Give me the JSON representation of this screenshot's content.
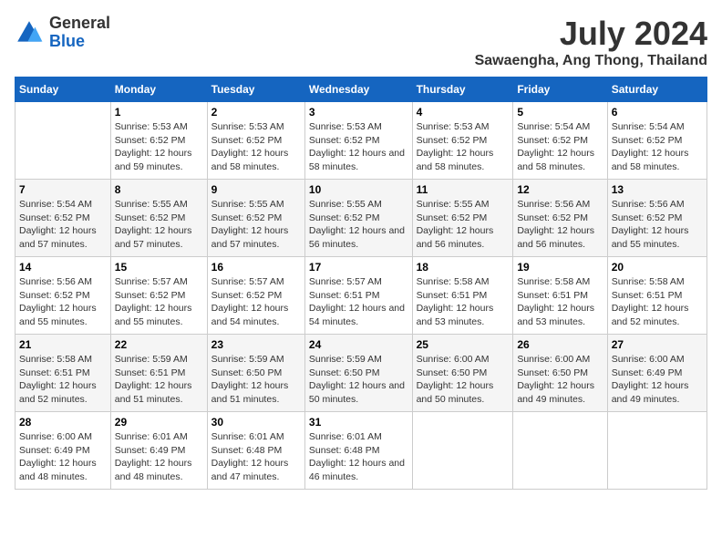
{
  "logo": {
    "general": "General",
    "blue": "Blue"
  },
  "header": {
    "month": "July 2024",
    "location": "Sawaengha, Ang Thong, Thailand"
  },
  "days_of_week": [
    "Sunday",
    "Monday",
    "Tuesday",
    "Wednesday",
    "Thursday",
    "Friday",
    "Saturday"
  ],
  "weeks": [
    [
      {
        "day": "",
        "empty": true
      },
      {
        "day": "1",
        "sunrise": "Sunrise: 5:53 AM",
        "sunset": "Sunset: 6:52 PM",
        "daylight": "Daylight: 12 hours and 59 minutes."
      },
      {
        "day": "2",
        "sunrise": "Sunrise: 5:53 AM",
        "sunset": "Sunset: 6:52 PM",
        "daylight": "Daylight: 12 hours and 58 minutes."
      },
      {
        "day": "3",
        "sunrise": "Sunrise: 5:53 AM",
        "sunset": "Sunset: 6:52 PM",
        "daylight": "Daylight: 12 hours and 58 minutes."
      },
      {
        "day": "4",
        "sunrise": "Sunrise: 5:53 AM",
        "sunset": "Sunset: 6:52 PM",
        "daylight": "Daylight: 12 hours and 58 minutes."
      },
      {
        "day": "5",
        "sunrise": "Sunrise: 5:54 AM",
        "sunset": "Sunset: 6:52 PM",
        "daylight": "Daylight: 12 hours and 58 minutes."
      },
      {
        "day": "6",
        "sunrise": "Sunrise: 5:54 AM",
        "sunset": "Sunset: 6:52 PM",
        "daylight": "Daylight: 12 hours and 58 minutes."
      }
    ],
    [
      {
        "day": "7",
        "sunrise": "Sunrise: 5:54 AM",
        "sunset": "Sunset: 6:52 PM",
        "daylight": "Daylight: 12 hours and 57 minutes."
      },
      {
        "day": "8",
        "sunrise": "Sunrise: 5:55 AM",
        "sunset": "Sunset: 6:52 PM",
        "daylight": "Daylight: 12 hours and 57 minutes."
      },
      {
        "day": "9",
        "sunrise": "Sunrise: 5:55 AM",
        "sunset": "Sunset: 6:52 PM",
        "daylight": "Daylight: 12 hours and 57 minutes."
      },
      {
        "day": "10",
        "sunrise": "Sunrise: 5:55 AM",
        "sunset": "Sunset: 6:52 PM",
        "daylight": "Daylight: 12 hours and 56 minutes."
      },
      {
        "day": "11",
        "sunrise": "Sunrise: 5:55 AM",
        "sunset": "Sunset: 6:52 PM",
        "daylight": "Daylight: 12 hours and 56 minutes."
      },
      {
        "day": "12",
        "sunrise": "Sunrise: 5:56 AM",
        "sunset": "Sunset: 6:52 PM",
        "daylight": "Daylight: 12 hours and 56 minutes."
      },
      {
        "day": "13",
        "sunrise": "Sunrise: 5:56 AM",
        "sunset": "Sunset: 6:52 PM",
        "daylight": "Daylight: 12 hours and 55 minutes."
      }
    ],
    [
      {
        "day": "14",
        "sunrise": "Sunrise: 5:56 AM",
        "sunset": "Sunset: 6:52 PM",
        "daylight": "Daylight: 12 hours and 55 minutes."
      },
      {
        "day": "15",
        "sunrise": "Sunrise: 5:57 AM",
        "sunset": "Sunset: 6:52 PM",
        "daylight": "Daylight: 12 hours and 55 minutes."
      },
      {
        "day": "16",
        "sunrise": "Sunrise: 5:57 AM",
        "sunset": "Sunset: 6:52 PM",
        "daylight": "Daylight: 12 hours and 54 minutes."
      },
      {
        "day": "17",
        "sunrise": "Sunrise: 5:57 AM",
        "sunset": "Sunset: 6:51 PM",
        "daylight": "Daylight: 12 hours and 54 minutes."
      },
      {
        "day": "18",
        "sunrise": "Sunrise: 5:58 AM",
        "sunset": "Sunset: 6:51 PM",
        "daylight": "Daylight: 12 hours and 53 minutes."
      },
      {
        "day": "19",
        "sunrise": "Sunrise: 5:58 AM",
        "sunset": "Sunset: 6:51 PM",
        "daylight": "Daylight: 12 hours and 53 minutes."
      },
      {
        "day": "20",
        "sunrise": "Sunrise: 5:58 AM",
        "sunset": "Sunset: 6:51 PM",
        "daylight": "Daylight: 12 hours and 52 minutes."
      }
    ],
    [
      {
        "day": "21",
        "sunrise": "Sunrise: 5:58 AM",
        "sunset": "Sunset: 6:51 PM",
        "daylight": "Daylight: 12 hours and 52 minutes."
      },
      {
        "day": "22",
        "sunrise": "Sunrise: 5:59 AM",
        "sunset": "Sunset: 6:51 PM",
        "daylight": "Daylight: 12 hours and 51 minutes."
      },
      {
        "day": "23",
        "sunrise": "Sunrise: 5:59 AM",
        "sunset": "Sunset: 6:50 PM",
        "daylight": "Daylight: 12 hours and 51 minutes."
      },
      {
        "day": "24",
        "sunrise": "Sunrise: 5:59 AM",
        "sunset": "Sunset: 6:50 PM",
        "daylight": "Daylight: 12 hours and 50 minutes."
      },
      {
        "day": "25",
        "sunrise": "Sunrise: 6:00 AM",
        "sunset": "Sunset: 6:50 PM",
        "daylight": "Daylight: 12 hours and 50 minutes."
      },
      {
        "day": "26",
        "sunrise": "Sunrise: 6:00 AM",
        "sunset": "Sunset: 6:50 PM",
        "daylight": "Daylight: 12 hours and 49 minutes."
      },
      {
        "day": "27",
        "sunrise": "Sunrise: 6:00 AM",
        "sunset": "Sunset: 6:49 PM",
        "daylight": "Daylight: 12 hours and 49 minutes."
      }
    ],
    [
      {
        "day": "28",
        "sunrise": "Sunrise: 6:00 AM",
        "sunset": "Sunset: 6:49 PM",
        "daylight": "Daylight: 12 hours and 48 minutes."
      },
      {
        "day": "29",
        "sunrise": "Sunrise: 6:01 AM",
        "sunset": "Sunset: 6:49 PM",
        "daylight": "Daylight: 12 hours and 48 minutes."
      },
      {
        "day": "30",
        "sunrise": "Sunrise: 6:01 AM",
        "sunset": "Sunset: 6:48 PM",
        "daylight": "Daylight: 12 hours and 47 minutes."
      },
      {
        "day": "31",
        "sunrise": "Sunrise: 6:01 AM",
        "sunset": "Sunset: 6:48 PM",
        "daylight": "Daylight: 12 hours and 46 minutes."
      },
      {
        "day": "",
        "empty": true
      },
      {
        "day": "",
        "empty": true
      },
      {
        "day": "",
        "empty": true
      }
    ]
  ]
}
